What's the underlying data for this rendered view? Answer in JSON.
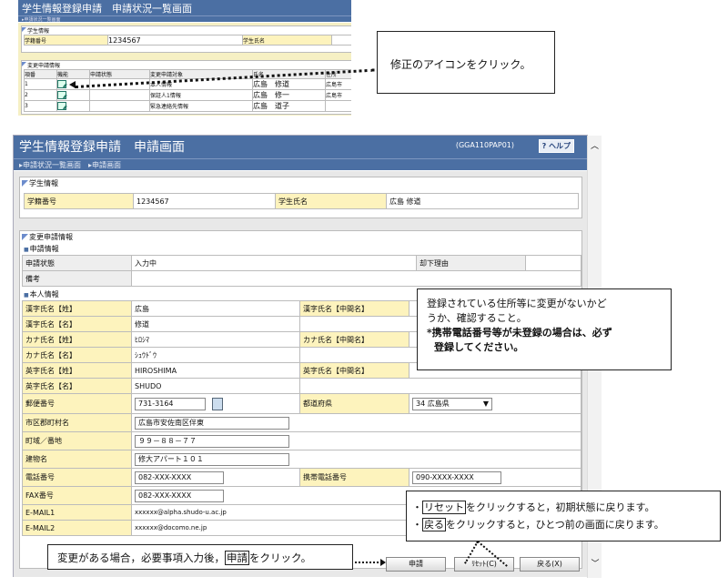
{
  "thumb": {
    "title": "学生情報登録申請　申請状況一覧画面",
    "crumb": "申請状況一覧画面",
    "student_section": "学生情報",
    "student_no_label": "学籍番号",
    "student_no": "1234567",
    "student_name_label": "学生氏名",
    "change_section": "変更申請情報",
    "columns": [
      "項番",
      "機能",
      "申請状態",
      "変更申請対象",
      "氏名",
      "住所"
    ],
    "rows": [
      {
        "no": "1",
        "target": "本人情報",
        "name": "広島　修道",
        "addr": "広島市"
      },
      {
        "no": "2",
        "target": "保証人1情報",
        "name": "広島　修一",
        "addr": "広島市"
      },
      {
        "no": "3",
        "target": "緊急連絡先情報",
        "name": "広島　道子",
        "addr": ""
      }
    ]
  },
  "callout_edit": "修正のアイコンをクリック。",
  "window": {
    "title": "学生情報登録申請　申請画面",
    "code": "(GGA110PAP01)",
    "help": "? ヘルプ",
    "crumb1": "申請状況一覧画面",
    "crumb2": "申請画面",
    "student_section": "学生情報",
    "student_no_label": "学籍番号",
    "student_no": "1234567",
    "student_name_label": "学生氏名",
    "student_name": "広島 修道",
    "change_section": "変更申請情報",
    "app_sub": "申請情報",
    "status_label": "申請状態",
    "status": "入力中",
    "reject_label": "却下理由",
    "remarks_label": "備考",
    "self_sub": "本人情報",
    "kanji_last_label": "漢字氏名【姓】",
    "kanji_last": "広島",
    "kanji_mid_label": "漢字氏名【中間名】",
    "kanji_first_label": "漢字氏名【名】",
    "kanji_first": "修道",
    "kana_last_label": "カナ氏名【姓】",
    "kana_last": "ﾋﾛｼﾏ",
    "kana_mid_label": "カナ氏名【中間名】",
    "kana_first_label": "カナ氏名【名】",
    "kana_first": "ｼｭｳﾄﾞｳ",
    "eng_last_label": "英字氏名【姓】",
    "eng_last": "HIROSHIMA",
    "eng_mid_label": "英字氏名【中間名】",
    "eng_first_label": "英字氏名【名】",
    "eng_first": "SHUDO",
    "zip_label": "郵便番号",
    "zip": "731-3164",
    "pref_label": "都道府県",
    "pref": "34 広島県",
    "city_label": "市区郡町村名",
    "city": "広島市安佐南区伴東",
    "town_label": "町域／番地",
    "town": "９９－８８－７７",
    "bldg_label": "建物名",
    "bldg": "修大アパート１０１",
    "tel_label": "電話番号",
    "tel": "082-XXX-XXXX",
    "mobile_label": "携帯電話番号",
    "mobile": "090-XXXX-XXXX",
    "fax_label": "FAX番号",
    "fax": "082-XXX-XXXX",
    "mail1_label": "E-MAIL1",
    "mail1": "xxxxxx@alpha.shudo-u.ac.jp",
    "mail2_label": "E-MAIL2",
    "mail2": "xxxxxx@docomo.ne.jp",
    "apply_btn": "申請",
    "reset_btn": "ﾘｾｯﾄ(C)",
    "back_btn": "戻る(X)"
  },
  "callout_check": {
    "line1": "登録されている住所等に変更がないかど",
    "line2": "うか、確認すること。",
    "line3": "*携帯電話番号等が未登録の場合は、必ず",
    "line4": "登録してください。"
  },
  "callout_reset": {
    "pre1": "・",
    "word1": "リセット",
    "post1": "をクリックすると，初期状態に戻ります。",
    "pre2": "・",
    "word2": "戻る",
    "post2": "をクリックすると，ひとつ前の画面に戻ります。"
  },
  "callout_apply": {
    "pre": "変更がある場合，必要事項入力後，",
    "word": "申請",
    "post": "をクリック。"
  }
}
